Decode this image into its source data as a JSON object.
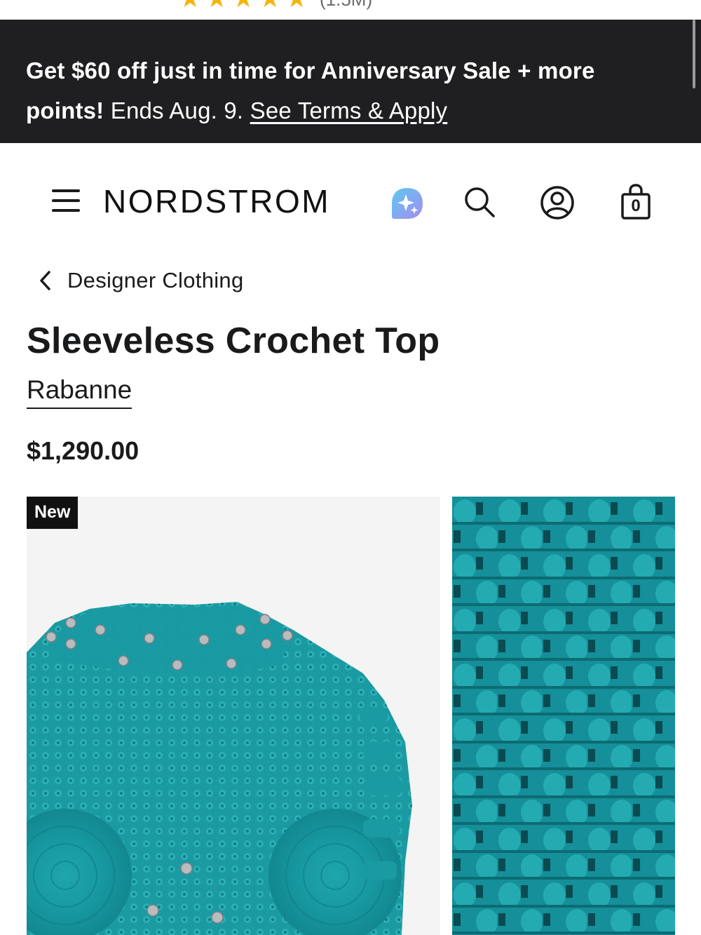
{
  "rating": {
    "count_label": "(1.5M)",
    "stars": 5
  },
  "promo": {
    "bold_text": "Get $60 off just in time for Anniversary Sale + more points!",
    "regular_text": " Ends Aug. 9. ",
    "link_text": "See Terms & Apply"
  },
  "header": {
    "logo": "NORDSTROM",
    "bag_count": "0",
    "icons": [
      "menu-icon",
      "ai-sparkle-icon",
      "search-icon",
      "account-icon",
      "shopping-bag-icon"
    ]
  },
  "breadcrumb": {
    "label": "Designer Clothing"
  },
  "product": {
    "title": "Sleeveless Crochet Top",
    "brand": "Rabanne",
    "price": "$1,290.00",
    "badge": "New",
    "color": "#1a9ba3"
  },
  "colors": {
    "banner_bg": "#1f1f21",
    "text": "#191a1b",
    "ai_gradient_start": "#5ec8f0",
    "ai_gradient_end": "#a58cf2"
  }
}
